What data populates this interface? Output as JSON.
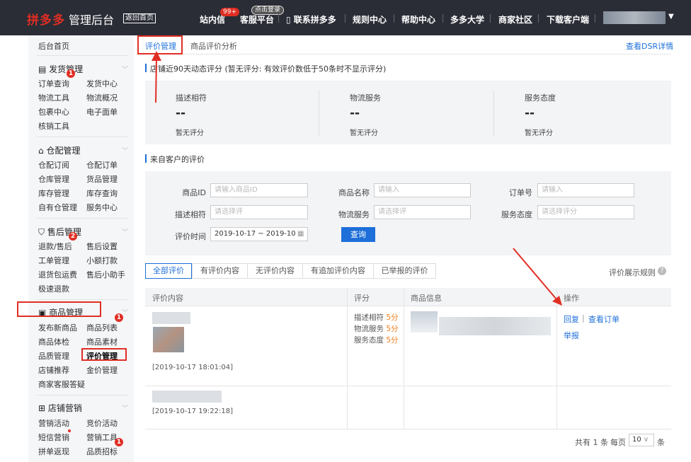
{
  "topbar": {
    "logo": "拼多多",
    "subtitle": "管理后台",
    "home_button": "返回首页",
    "nav": [
      "站内信",
      "客服平台",
      "联系拼多多",
      "规则中心",
      "帮助中心",
      "多多大学",
      "商家社区",
      "下载客户端"
    ],
    "msg_badge": "99+",
    "cs_badge": "点击登录"
  },
  "sidebar": {
    "home": "后台首页",
    "groups": [
      {
        "title": "发货管理",
        "badge": "1",
        "links": [
          "订单查询",
          "发货中心",
          "物流工具",
          "物流概况",
          "包裹中心",
          "电子面单",
          "核销工具"
        ]
      },
      {
        "title": "仓配管理",
        "links": [
          "仓配订阅",
          "仓配订单",
          "仓库管理",
          "货品管理",
          "库存管理",
          "库存查询",
          "自有仓管理",
          "服务中心"
        ]
      },
      {
        "title": "售后管理",
        "badge": "2",
        "links": [
          "退款/售后",
          "售后设置",
          "工单管理",
          "小额打款",
          "退货包运费",
          "售后小助手",
          "极速退款"
        ]
      },
      {
        "title": "商品管理",
        "badge": "1",
        "links": [
          "发布新商品",
          "商品列表",
          "商品体检",
          "商品素材",
          "品质管理",
          "评价管理",
          "店铺推荐",
          "金价管理",
          "商家客服答疑"
        ]
      },
      {
        "title": "店铺营销",
        "badge": "1",
        "links": [
          "营销活动",
          "竞价活动",
          "短信营销",
          "营销工具",
          "拼单返现",
          "品质招标"
        ]
      }
    ]
  },
  "main": {
    "tabs": [
      "评价管理",
      "商品评价分析"
    ],
    "dsr_link": "查看DSR详情",
    "dsr_title": "店铺近90天动态评分 (暂无评分: 有效评价数低于50条时不显示评分)",
    "dsr": [
      {
        "label": "描述相符",
        "value": "--",
        "sub": "暂无评分"
      },
      {
        "label": "物流服务",
        "value": "--",
        "sub": "暂无评分"
      },
      {
        "label": "服务态度",
        "value": "--",
        "sub": "暂无评分"
      }
    ],
    "reviews_title": "来自客户的评价",
    "filters": {
      "product_id": {
        "label": "商品ID",
        "placeholder": "请输入商品ID"
      },
      "product_name": {
        "label": "商品名称",
        "placeholder": "请输入"
      },
      "order_no": {
        "label": "订单号",
        "placeholder": "请输入"
      },
      "desc_match": {
        "label": "描述相符",
        "placeholder": "请选择评"
      },
      "logistics": {
        "label": "物流服务",
        "placeholder": "请选择评"
      },
      "service": {
        "label": "服务态度",
        "placeholder": "请选择评分"
      },
      "time": {
        "label": "评价时间",
        "value": "2019-10-17 ~ 2019-10"
      },
      "query_button": "查询"
    },
    "review_tabs": [
      "全部评价",
      "有评价内容",
      "无评价内容",
      "有追加评价内容",
      "已举报的评价"
    ],
    "rules_link": "评价展示规则",
    "table": {
      "headers": [
        "评价内容",
        "评分",
        "商品信息",
        "操作"
      ],
      "rows": [
        {
          "time": "[2019-10-17 18:01:04]",
          "scores": [
            {
              "label": "描述相符",
              "value": "5分"
            },
            {
              "label": "物流服务",
              "value": "5分"
            },
            {
              "label": "服务态度",
              "value": "5分"
            }
          ],
          "actions": [
            "回复",
            "查看订单",
            "举报"
          ]
        },
        {
          "time": "[2019-10-17 19:22:18]"
        }
      ]
    },
    "pagination": {
      "total": "共有 1 条",
      "per_page_label": "每页",
      "per_page": "10",
      "unit": "条"
    }
  }
}
